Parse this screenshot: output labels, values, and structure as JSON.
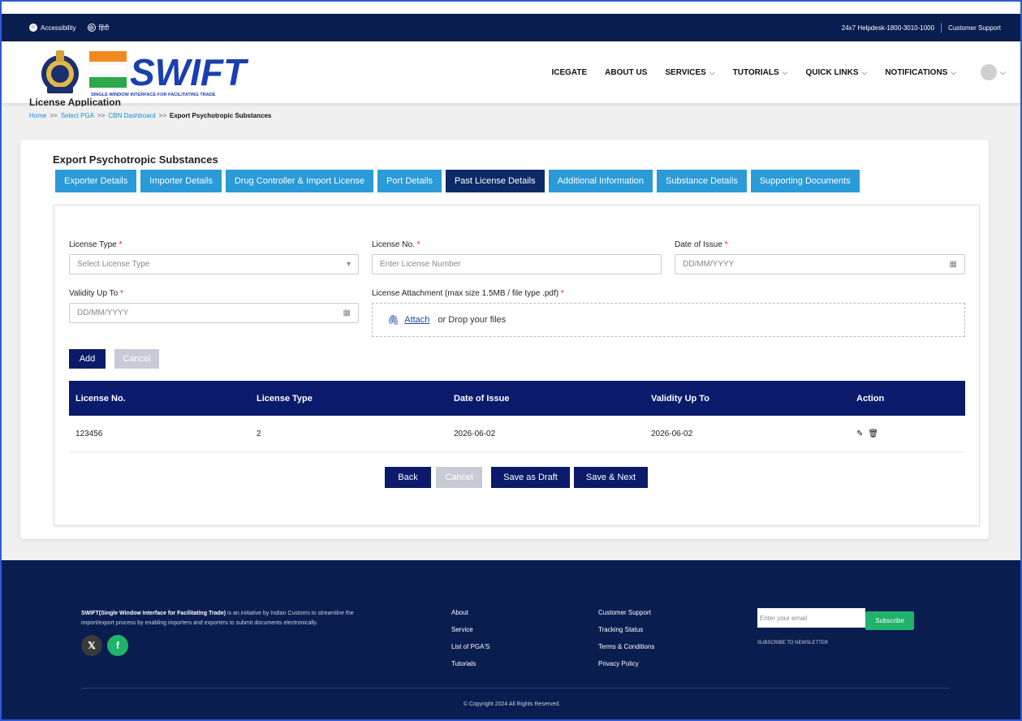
{
  "util_bar": {
    "accessibility": "Accessibility",
    "language": "हिंदी",
    "helpdesk": "24x7 Helpdesk-1800-3010-1000",
    "customer_support": "Customer Support"
  },
  "header": {
    "logo_text": "SWIFT",
    "logo_tagline": "SINGLE WINDOW INTERFACE FOR FACILITATING TRADE",
    "nav": [
      {
        "label": "ICEGATE"
      },
      {
        "label": "ABOUT US"
      },
      {
        "label": "SERVICES"
      },
      {
        "label": "TUTORIALS"
      },
      {
        "label": "QUICK LINKS"
      },
      {
        "label": "NOTIFICATIONS"
      }
    ]
  },
  "page": {
    "title": "License Application",
    "breadcrumb": [
      "Home",
      "Select PGA",
      "CBN Dashboard",
      "Export Psychotropic Substances"
    ]
  },
  "card": {
    "title": "Export Psychotropic Substances",
    "tabs": [
      "Exporter Details",
      "Importer Details",
      "Drug Controller & Import License",
      "Port Details",
      "Past License Details",
      "Additional Information",
      "Substance Details",
      "Supporting Documents"
    ],
    "active_tab": "Past License Details"
  },
  "form": {
    "license_type_label": "License Type",
    "license_type_placeholder": "Select License Type",
    "license_no_label": "License No.",
    "license_no_placeholder": "Enter License Number",
    "date_issue_label": "Date of Issue",
    "date_issue_placeholder": "DD/MM/YYYY",
    "validity_label": "Validity Up To",
    "validity_placeholder": "DD/MM/YYYY",
    "attachment_label": "License Attachment (max size 1.5MB / file type .pdf)",
    "attach_link": "Attach",
    "drop_text": "or Drop your files",
    "add_button": "Add",
    "cancel_button": "Cancel",
    "required_mark": "*"
  },
  "table": {
    "headers": [
      "License No.",
      "License Type",
      "Date of Issue",
      "Validity Up To",
      "Action"
    ],
    "rows": [
      {
        "license_no": "123456",
        "license_type": "2",
        "date_issue": "2026-06-02",
        "validity": "2026-06-02"
      }
    ]
  },
  "actions": {
    "back": "Back",
    "cancel": "Cancel",
    "save_draft": "Save as Draft",
    "save_next": "Save & Next"
  },
  "footer": {
    "about_bold": "SWIFT(Single Window Interface for Facilitating Trade)",
    "about_text": " is an initiative by Indian Customs to streamline the import/export process by enabling importers and exporters to submit documents electronically.",
    "col1": [
      "About",
      "Service",
      "List of PGA'S",
      "Tutorials"
    ],
    "col2": [
      "Customer Support",
      "Tracking Status",
      "Terms & Conditions",
      "Privacy Policy"
    ],
    "email_placeholder": "Enter your email",
    "subscribe": "Subscribe",
    "newsletter": "SUBSCRIBE TO NEWSLETTER",
    "copyright": "© Copyright 2024 All Rights Reserved."
  }
}
